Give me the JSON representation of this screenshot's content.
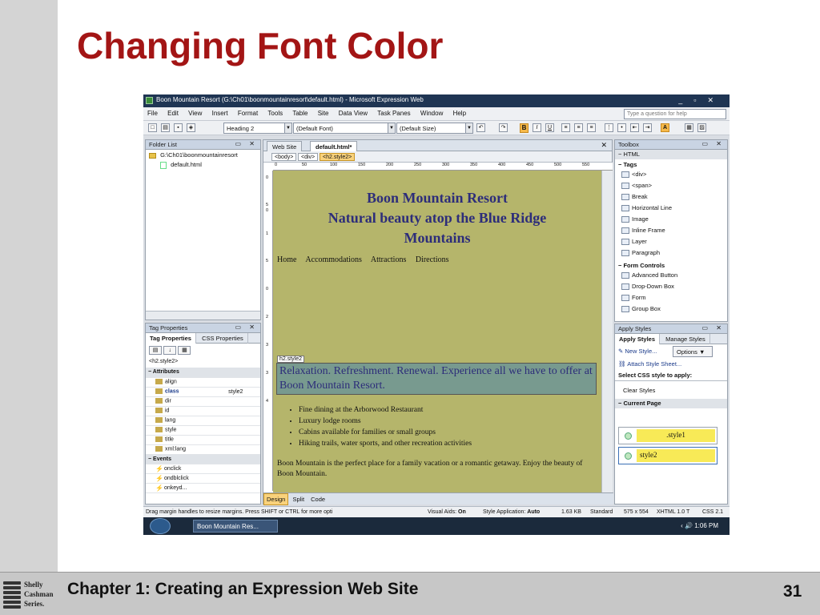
{
  "slide": {
    "title": "Changing Font Color",
    "footer": "Chapter 1: Creating an Expression Web Site",
    "page_number": "31",
    "logo_text": [
      "Shelly",
      "Cashman",
      "Series."
    ]
  },
  "app": {
    "window_title": "Boon Mountain Resort (G:\\Ch01\\boonmountainresort\\default.html) - Microsoft Expression Web",
    "menu": [
      "File",
      "Edit",
      "View",
      "Insert",
      "Format",
      "Tools",
      "Table",
      "Site",
      "Data View",
      "Task Panes",
      "Window",
      "Help"
    ],
    "help_placeholder": "Type a question for help",
    "toolbar": {
      "style_select": "Heading 2",
      "font_select": "(Default Font)",
      "size_select": "(Default Size)",
      "bold": "B",
      "italic": "I",
      "underline": "U"
    },
    "folder_list": {
      "title": "Folder List",
      "root": "G:\\Ch01\\boonmountainresort",
      "file": "default.html"
    },
    "tag_properties": {
      "title": "Tag Properties",
      "tabs": [
        "Tag Properties",
        "CSS Properties"
      ],
      "current_tag": "<h2.style2>",
      "attributes_header": "Attributes",
      "attributes": [
        {
          "name": "align",
          "value": ""
        },
        {
          "name": "class",
          "value": "style2"
        },
        {
          "name": "dir",
          "value": ""
        },
        {
          "name": "id",
          "value": ""
        },
        {
          "name": "lang",
          "value": ""
        },
        {
          "name": "style",
          "value": ""
        },
        {
          "name": "title",
          "value": ""
        },
        {
          "name": "xml:lang",
          "value": ""
        }
      ],
      "events_header": "Events",
      "events": [
        "onclick",
        "ondblclick",
        "onkeyd..."
      ]
    },
    "editor": {
      "tabs": [
        "Web Site",
        "default.html*"
      ],
      "breadcrumbs": [
        "<body>",
        "<div>",
        "<h2.style2>"
      ],
      "ruler_ticks": [
        "0",
        "50",
        "100",
        "150",
        "200",
        "250",
        "300",
        "350",
        "400",
        "450",
        "500",
        "550"
      ],
      "vruler_ticks": [
        "0",
        "5",
        "0",
        "1",
        "5",
        "2",
        "0",
        "2",
        "5",
        "3",
        "0",
        "3",
        "5",
        "4",
        "0"
      ],
      "page": {
        "site_title_lines": [
          "Boon Mountain Resort",
          "Natural beauty atop the Blue Ridge",
          "Mountains"
        ],
        "nav": [
          "Home",
          "Accommodations",
          "Attractions",
          "Directions"
        ],
        "selected_tag": "h2.style2",
        "h2_text": "Relaxation. Refreshment. Renewal. Experience all we have to offer at Boon Mountain Resort.",
        "features": [
          "Fine dining at the Arborwood Restaurant",
          "Luxury lodge rooms",
          "Cabins available for families or small groups",
          "Hiking trails, water sports, and other recreation activities"
        ],
        "paragraph": "Boon Mountain is the perfect place for a family vacation or a romantic getaway. Enjoy the beauty of Boon Mountain."
      },
      "view_tabs": [
        "Design",
        "Split",
        "Code"
      ]
    },
    "toolbox": {
      "title": "Toolbox",
      "html_header": "HTML",
      "tags_header": "Tags",
      "tags": [
        "<div>",
        "<span>",
        "Break",
        "Horizontal Line",
        "Image",
        "Inline Frame",
        "Layer",
        "Paragraph"
      ],
      "form_header": "Form Controls",
      "form_controls": [
        "Advanced Button",
        "Drop-Down Box",
        "Form",
        "Group Box"
      ]
    },
    "apply_styles": {
      "title": "Apply Styles",
      "tabs": [
        "Apply Styles",
        "Manage Styles"
      ],
      "new_style": "New Style...",
      "options": "Options",
      "attach": "Attach Style Sheet...",
      "select_label": "Select CSS style to apply:",
      "clear": "Clear Styles",
      "current_page": "Current Page",
      "styles": [
        ".style1",
        "style2"
      ]
    },
    "statusbar": {
      "hint": "Drag margin handles to resize margins. Press SHIFT or CTRL for more opti",
      "visual_aids_label": "Visual Aids:",
      "visual_aids": "On",
      "style_app_label": "Style Application:",
      "style_app": "Auto",
      "size": "1.63 KB",
      "mode": "Standard",
      "dims": "575 x 554",
      "doctype": "XHTML 1.0 T",
      "css": "CSS 2.1"
    },
    "taskbar": {
      "task": "Boon Mountain Res...",
      "time": "1:06 PM"
    }
  }
}
